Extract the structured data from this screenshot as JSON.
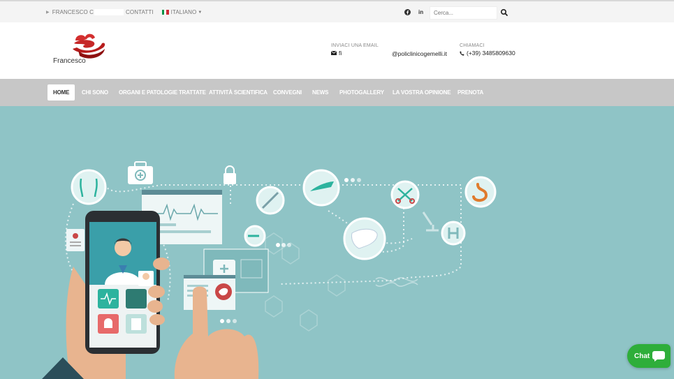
{
  "topbar": {
    "owner_label": "FRANCESCO C",
    "contacts_label": "CONTATTI",
    "language_label": "ITALIANO",
    "facebook_icon": "facebook-icon",
    "linkedin_label": "in",
    "search_placeholder": "Cerca..."
  },
  "header": {
    "logo_name": "Francesco",
    "email_title": "INVIACI UNA EMAIL",
    "email_value": "fi",
    "email_domain": "@policlinicogemelli.it",
    "phone_title": "CHIAMACI",
    "phone_value": "(+39) 3485809630"
  },
  "nav": {
    "items": [
      "HOME",
      "CHI SONO",
      "ORGANI E PATOLOGIE TRATTATE",
      "ATTIVITÀ SCIENTIFICA",
      "CONVEGNI",
      "NEWS",
      "PHOTOGALLERY",
      "LA VOSTRA OPINIONE",
      "PRENOTA"
    ],
    "active_index": 0
  },
  "hero": {
    "icons": [
      "torso-icon",
      "medical-case-icon",
      "lock-icon",
      "ecg-monitor-icon",
      "syringe-icon",
      "scalpel-icon",
      "scissors-icon",
      "stomach-icon",
      "liver-icon",
      "microscope-icon",
      "hospital-h-icon",
      "clipboard-icon",
      "doctor-avatar-icon",
      "dna-icon"
    ]
  },
  "chat": {
    "label": "Chat"
  },
  "colors": {
    "hero_bg": "#8fc4c6",
    "nav_bg": "#c7c7c7",
    "brand_red": "#c62828",
    "chat_green": "#2eae3a"
  }
}
